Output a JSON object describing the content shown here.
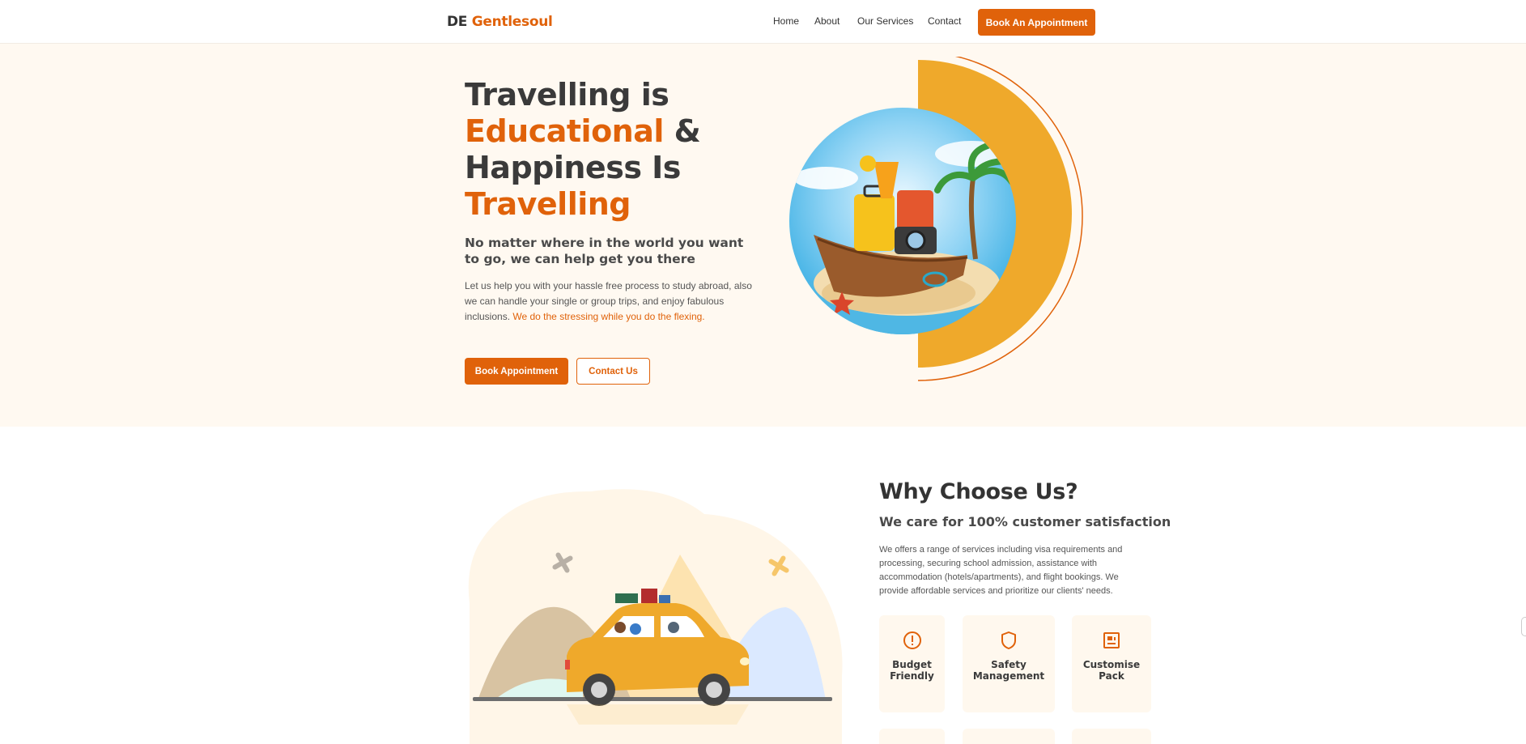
{
  "header": {
    "logo_prefix": "DE",
    "logo_brand": "Gentlesoul",
    "nav": [
      "Home",
      "About",
      "Our Services",
      "Contact"
    ],
    "cta": "Book An Appointment"
  },
  "hero": {
    "title_1": "Travelling is",
    "title_2_accent": "Educational",
    "title_2_rest": " &",
    "title_3": "Happiness Is",
    "title_4_accent": "Travelling",
    "subtitle": "No matter where in the world you want to go, we can help get you there",
    "body": "Let us help you with your hassle free process to study abroad, also we can handle your single or group trips, and enjoy fabulous inclusions. ",
    "body_accent": "We do the stressing while you do the flexing.",
    "primary_button": "Book Appointment",
    "secondary_button": "Contact Us"
  },
  "why": {
    "title": "Why Choose Us?",
    "subtitle": "We care for 100% customer satisfaction",
    "body": "We offers a range of services including visa requirements and processing, securing school admission, assistance with accommodation (hotels/apartments), and flight bookings. We provide affordable services and prioritize our clients' needs.",
    "features": [
      {
        "label": "Budget Friendly",
        "icon": "alert-circle-icon"
      },
      {
        "label": "Safety Management",
        "icon": "shield-icon"
      },
      {
        "label": "Customise Pack",
        "icon": "customise-box-icon"
      }
    ]
  },
  "colors": {
    "accent": "#e0620a",
    "gold": "#efa92b",
    "hero_bg": "#fff9f1",
    "card_bg": "#fff8ee"
  }
}
